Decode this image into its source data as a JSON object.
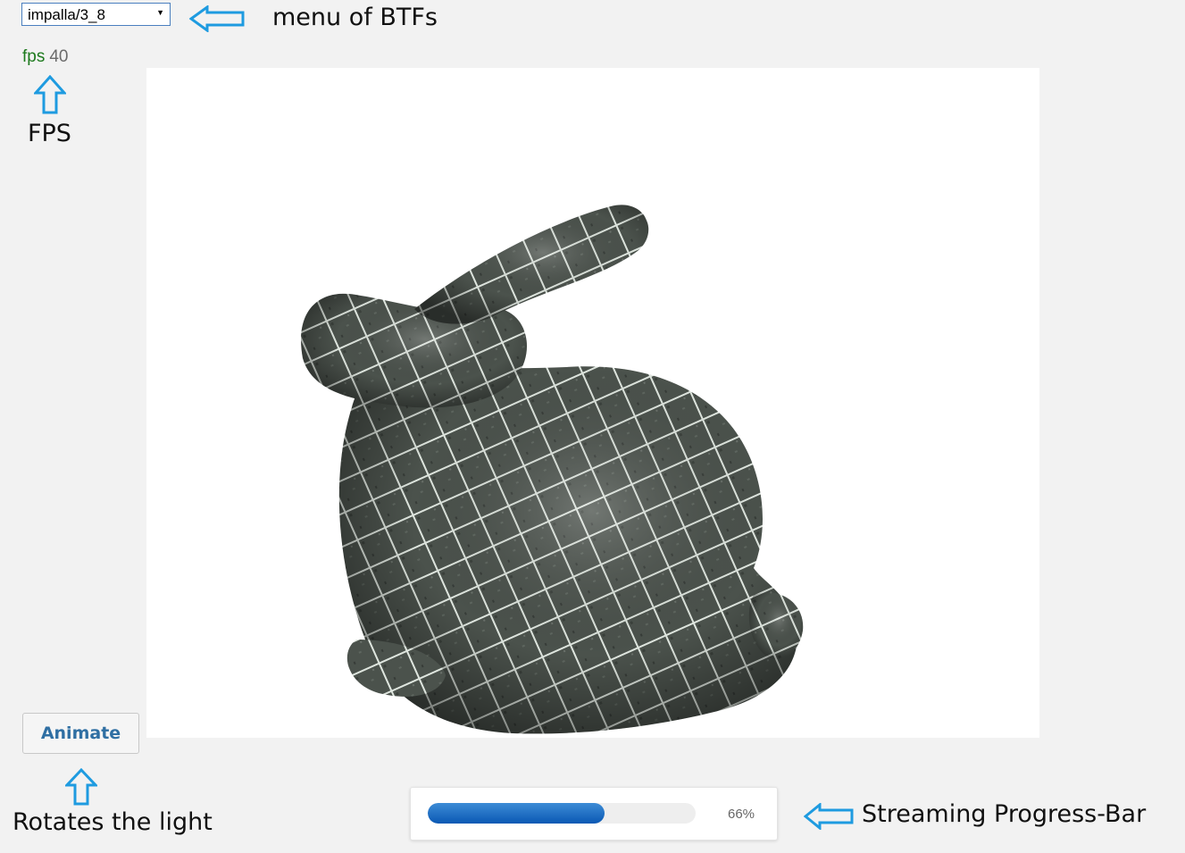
{
  "btf_menu": {
    "selected": "impalla/3_8",
    "icon": "chevron-down-icon"
  },
  "fps_display": {
    "label": "fps",
    "value": "40"
  },
  "annotations": {
    "menu": "menu of BTFs",
    "fps": "FPS",
    "animate": "Rotates the light",
    "progress": "Streaming Progress-Bar"
  },
  "animate_button": {
    "label": "Animate"
  },
  "progress": {
    "percent_label": "66%",
    "fraction": 0.66
  },
  "colors": {
    "arrow": "#1e9be0",
    "fps_label": "#1e7a1e",
    "button_text": "#2f6fa3",
    "progress_fill": "#0a58b4"
  },
  "icons": {
    "arrow": "hollow-arrow-icon",
    "bunny": "stanford-bunny-render"
  }
}
